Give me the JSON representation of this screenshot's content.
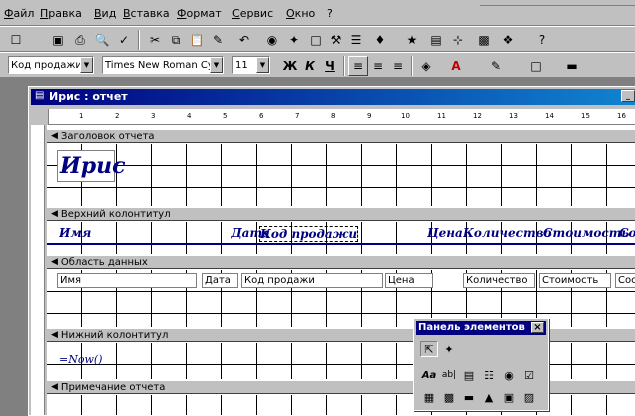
{
  "menu": [
    "Файл",
    "Правка",
    "Вид",
    "Вставка",
    "Формат",
    "Сервис",
    "Окно",
    "?"
  ],
  "format_bar": {
    "control_combo": "Код продажи I",
    "font_combo": "Times New Roman Cyr",
    "size_combo": "11",
    "bold": "Ж",
    "italic": "К",
    "underline": "Ч"
  },
  "window": {
    "title": "Ирис : отчет"
  },
  "ruler": [
    "1",
    "2",
    "3",
    "4",
    "5",
    "6",
    "7",
    "8",
    "9",
    "10",
    "11",
    "12",
    "13",
    "14",
    "15",
    "16"
  ],
  "sections": {
    "report_header": "Заголовок отчета",
    "page_header": "Верхний колонтитул",
    "detail": "Область данных",
    "page_footer": "Нижний колонтитул",
    "report_footer": "Примечание отчета"
  },
  "report_title": "Ирис",
  "header_labels": [
    "Имя",
    "Дата",
    "Код продажи",
    "Цена",
    "Количество",
    "Стоимость",
    "Сос"
  ],
  "detail_fields": [
    "Имя",
    "Дата",
    "Код продажи",
    "Цена",
    "Количество",
    "Стоимость",
    "Сост"
  ],
  "footer_expr": "=Now()",
  "toolbox": {
    "title": "Панель элементов",
    "close": "×"
  }
}
